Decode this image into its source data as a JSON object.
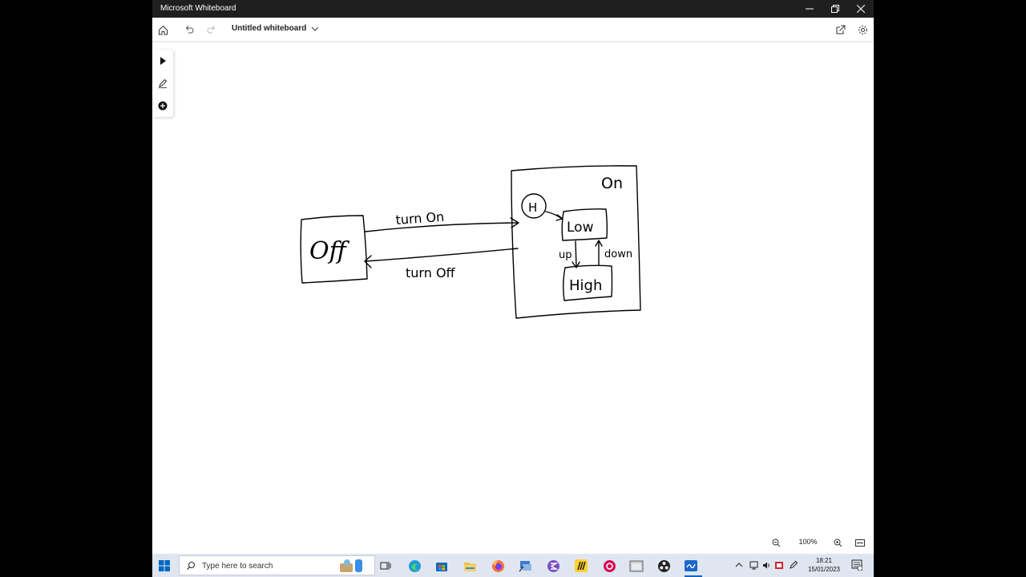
{
  "window": {
    "title": "Microsoft Whiteboard",
    "controls": [
      "minimize",
      "restore",
      "close"
    ]
  },
  "toolbar": {
    "board_title": "Untitled whiteboard",
    "buttons": [
      "home-icon",
      "undo-icon",
      "redo-icon",
      "share-icon",
      "settings-icon"
    ]
  },
  "side_tools": [
    "select-icon",
    "pen-icon",
    "add-icon"
  ],
  "drawing": {
    "states": {
      "off": "Off",
      "on": "On",
      "initial": "H",
      "low": "Low",
      "high": "High"
    },
    "transitions": {
      "turn_on": "turn On",
      "turn_off": "turn Off",
      "up": "up",
      "down": "down"
    }
  },
  "zoom": {
    "level": "100%"
  },
  "taskbar": {
    "search_placeholder": "Type here to search",
    "apps": [
      "task-view",
      "edge",
      "microsoft-store",
      "file-explorer",
      "firefox",
      "app-icon-blue",
      "emacs",
      "miro",
      "debian",
      "tool-window",
      "obs",
      "whiteboard"
    ],
    "clock_time": "18:21",
    "clock_date": "15/01/2023",
    "accent": "#0067c0"
  }
}
